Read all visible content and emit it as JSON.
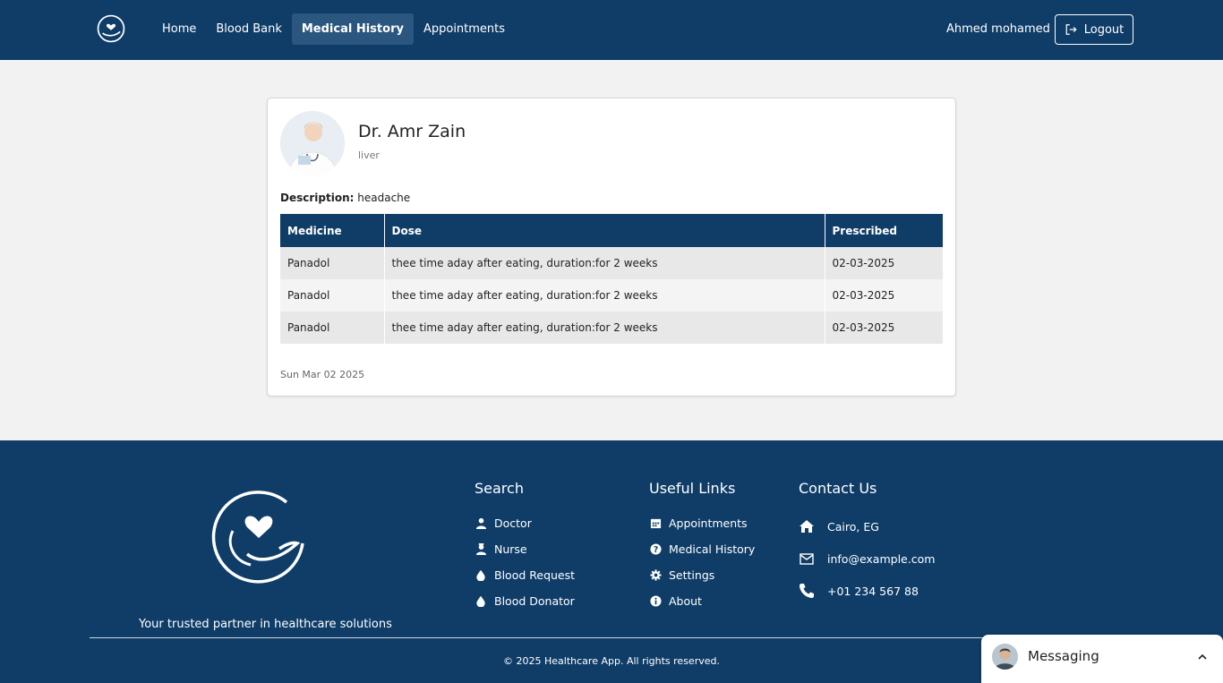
{
  "nav": {
    "links": [
      {
        "label": "Home",
        "active": false
      },
      {
        "label": "Blood Bank",
        "active": false
      },
      {
        "label": "Medical History",
        "active": true
      },
      {
        "label": "Appointments",
        "active": false
      }
    ],
    "user_name": "Ahmed mohamed",
    "logout_label": "Logout",
    "logo_icon": "heart-hand-logo-icon",
    "logout_icon": "logout-icon"
  },
  "record": {
    "doctor_name": "Dr. Amr Zain",
    "specialty": "liver",
    "description_label": "Description:",
    "description": "headache",
    "table": {
      "headers": [
        "Medicine",
        "Dose",
        "Prescribed"
      ],
      "rows": [
        [
          "Panadol",
          "thee time aday after eating, duration:for 2 weeks",
          "02-03-2025"
        ],
        [
          "Panadol",
          "thee time aday after eating, duration:for 2 weeks",
          "02-03-2025"
        ],
        [
          "Panadol",
          "thee time aday after eating, duration:for 2 weeks",
          "02-03-2025"
        ]
      ]
    },
    "date": "Sun Mar 02 2025"
  },
  "footer": {
    "tagline": "Your trusted partner in healthcare solutions",
    "search": {
      "title": "Search",
      "items": [
        {
          "label": "Doctor",
          "icon": "doctor-icon"
        },
        {
          "label": "Nurse",
          "icon": "nurse-icon"
        },
        {
          "label": "Blood Request",
          "icon": "blood-drop-icon"
        },
        {
          "label": "Blood Donator",
          "icon": "blood-drop-icon"
        }
      ]
    },
    "links": {
      "title": "Useful Links",
      "items": [
        {
          "label": "Appointments",
          "icon": "calendar-icon"
        },
        {
          "label": "Medical History",
          "icon": "question-circle-icon"
        },
        {
          "label": "Settings",
          "icon": "gear-icon"
        },
        {
          "label": "About",
          "icon": "info-icon"
        }
      ]
    },
    "contact": {
      "title": "Contact Us",
      "items": [
        {
          "label": "Cairo, EG",
          "icon": "home-icon"
        },
        {
          "label": "info@example.com",
          "icon": "envelope-icon"
        },
        {
          "label": "+01 234 567 88",
          "icon": "phone-icon"
        }
      ]
    },
    "copyright": "© 2025 Healthcare App. All rights reserved."
  },
  "messaging": {
    "label": "Messaging",
    "icon": "chevron-up-icon"
  },
  "colors": {
    "primary": "#0f3d68",
    "nav_active": "#2a5680",
    "page_bg": "#f2f2f2"
  }
}
